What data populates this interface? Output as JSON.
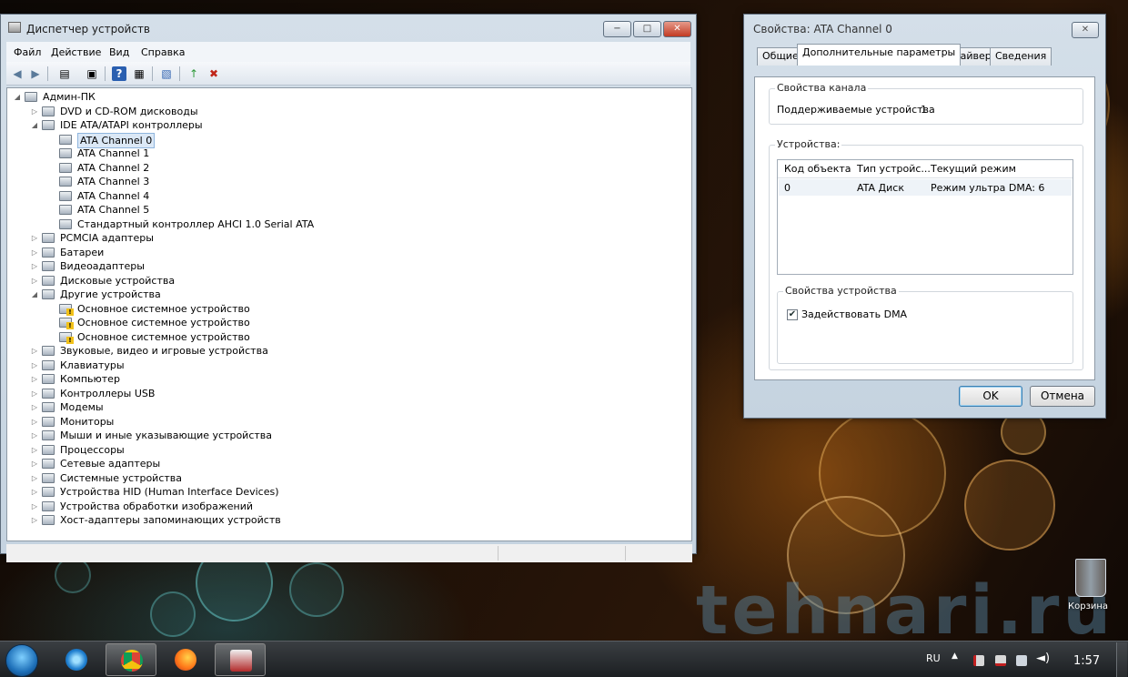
{
  "colors": {
    "window_frame": "#c5d3e0",
    "selection": "#dbe8f6",
    "close_button": "#c23a22",
    "warning": "#f2c21a",
    "taskbar": "#1c1f22"
  },
  "device_manager": {
    "title": "Диспетчер устройств",
    "menu": [
      "Файл",
      "Действие",
      "Вид",
      "Справка"
    ],
    "toolbar_icons": [
      "back-icon",
      "forward-icon",
      "properties-icon",
      "show-icon",
      "help-icon",
      "details-icon",
      "scan-icon",
      "update-driver-icon",
      "disable-device-icon"
    ],
    "tree": [
      {
        "label": "Админ-ПК",
        "depth": 0,
        "expander": "open",
        "icon": "computer-icon"
      },
      {
        "label": "DVD и CD-ROM дисководы",
        "depth": 1,
        "expander": "closed",
        "icon": "dvd-icon"
      },
      {
        "label": "IDE ATA/ATAPI контроллеры",
        "depth": 1,
        "expander": "open",
        "icon": "ide-controller-icon"
      },
      {
        "label": "ATA Channel 0",
        "depth": 2,
        "expander": "none",
        "icon": "ide-channel-icon",
        "selected": true
      },
      {
        "label": "ATA Channel 1",
        "depth": 2,
        "expander": "none",
        "icon": "ide-channel-icon"
      },
      {
        "label": "ATA Channel 2",
        "depth": 2,
        "expander": "none",
        "icon": "ide-channel-icon"
      },
      {
        "label": "ATA Channel 3",
        "depth": 2,
        "expander": "none",
        "icon": "ide-channel-icon"
      },
      {
        "label": "ATA Channel 4",
        "depth": 2,
        "expander": "none",
        "icon": "ide-channel-icon"
      },
      {
        "label": "ATA Channel 5",
        "depth": 2,
        "expander": "none",
        "icon": "ide-channel-icon"
      },
      {
        "label": "Стандартный контроллер AHCI 1.0 Serial ATA",
        "depth": 2,
        "expander": "none",
        "icon": "ide-channel-icon"
      },
      {
        "label": "PCMCIA адаптеры",
        "depth": 1,
        "expander": "closed",
        "icon": "pcmcia-icon"
      },
      {
        "label": "Батареи",
        "depth": 1,
        "expander": "closed",
        "icon": "battery-icon"
      },
      {
        "label": "Видеоадаптеры",
        "depth": 1,
        "expander": "closed",
        "icon": "display-adapter-icon"
      },
      {
        "label": "Дисковые устройства",
        "depth": 1,
        "expander": "closed",
        "icon": "disk-drive-icon"
      },
      {
        "label": "Другие устройства",
        "depth": 1,
        "expander": "open",
        "icon": "other-devices-icon"
      },
      {
        "label": "Основное системное устройство",
        "depth": 2,
        "expander": "none",
        "icon": "warning-device-icon",
        "warn": true
      },
      {
        "label": "Основное системное устройство",
        "depth": 2,
        "expander": "none",
        "icon": "warning-device-icon",
        "warn": true
      },
      {
        "label": "Основное системное устройство",
        "depth": 2,
        "expander": "none",
        "icon": "warning-device-icon",
        "warn": true
      },
      {
        "label": "Звуковые, видео и игровые устройства",
        "depth": 1,
        "expander": "closed",
        "icon": "speaker-icon"
      },
      {
        "label": "Клавиатуры",
        "depth": 1,
        "expander": "closed",
        "icon": "keyboard-icon"
      },
      {
        "label": "Компьютер",
        "depth": 1,
        "expander": "closed",
        "icon": "computer-icon"
      },
      {
        "label": "Контроллеры USB",
        "depth": 1,
        "expander": "closed",
        "icon": "usb-icon"
      },
      {
        "label": "Модемы",
        "depth": 1,
        "expander": "closed",
        "icon": "modem-icon"
      },
      {
        "label": "Мониторы",
        "depth": 1,
        "expander": "closed",
        "icon": "monitor-icon"
      },
      {
        "label": "Мыши и иные указывающие устройства",
        "depth": 1,
        "expander": "closed",
        "icon": "mouse-icon"
      },
      {
        "label": "Процессоры",
        "depth": 1,
        "expander": "closed",
        "icon": "processor-icon"
      },
      {
        "label": "Сетевые адаптеры",
        "depth": 1,
        "expander": "closed",
        "icon": "network-adapter-icon"
      },
      {
        "label": "Системные устройства",
        "depth": 1,
        "expander": "closed",
        "icon": "system-device-icon"
      },
      {
        "label": "Устройства HID (Human Interface Devices)",
        "depth": 1,
        "expander": "closed",
        "icon": "hid-icon"
      },
      {
        "label": "Устройства обработки изображений",
        "depth": 1,
        "expander": "closed",
        "icon": "imaging-device-icon"
      },
      {
        "label": "Хост-адаптеры запоминающих устройств",
        "depth": 1,
        "expander": "closed",
        "icon": "storage-adapter-icon"
      }
    ]
  },
  "properties_dialog": {
    "title": "Свойства: ATA Channel 0",
    "tabs": [
      "Общие",
      "Дополнительные параметры",
      "Драйвер",
      "Сведения"
    ],
    "active_tab": 1,
    "channel_group": {
      "title": "Свойства канала",
      "supported_label": "Поддерживаемые устройства",
      "supported_value": "1"
    },
    "devices_group": {
      "title": "Устройства:",
      "columns": [
        "Код объекта",
        "Тип устройс...",
        "Текущий режим"
      ],
      "rows": [
        {
          "id": "0",
          "type": "ATA Диск",
          "mode": "Режим ультра DMA: 6"
        }
      ]
    },
    "device_props_group": {
      "title": "Свойства устройства",
      "dma_label": "Задействовать DMA",
      "dma_checked": true
    },
    "ok_label": "OK",
    "cancel_label": "Отмена"
  },
  "desktop": {
    "recycle_bin_label": "Корзина",
    "watermark": "tehnari.ru"
  },
  "taskbar": {
    "apps": [
      "ie-icon",
      "chrome-icon",
      "firefox-icon",
      "device-manager-icon"
    ],
    "active_app": 1,
    "language": "RU",
    "clock": "1:57"
  }
}
